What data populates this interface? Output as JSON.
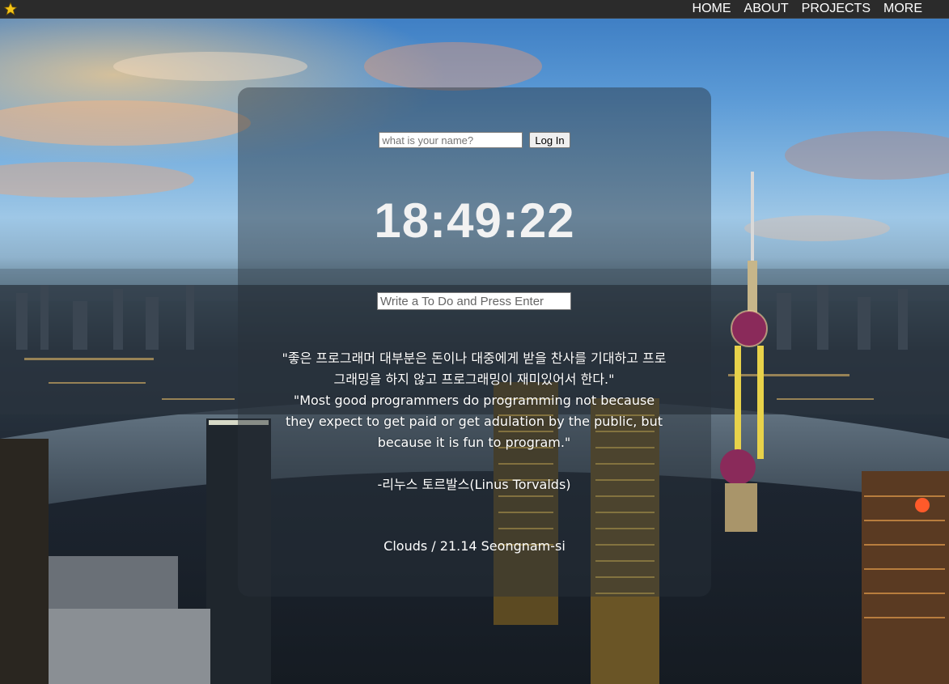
{
  "nav": {
    "items": [
      "HOME",
      "ABOUT",
      "PROJECTS",
      "MORE"
    ]
  },
  "login": {
    "placeholder": "what is your name?",
    "button_label": "Log In"
  },
  "clock": {
    "time": "18:49:22"
  },
  "todo": {
    "placeholder": "Write a To Do and Press Enter"
  },
  "quote": {
    "korean": "\"좋은 프로그래머 대부분은 돈이나 대중에게 받을 찬사를 기대하고 프로그래밍을 하지 않고 프로그래밍이 재미있어서 한다.\"",
    "english": "\"Most good programmers do programming not because they expect to get paid or get adulation by the public, but because it is fun to program.\"",
    "author": "-리누스 토르발스(Linus Torvalds)"
  },
  "weather": {
    "text": "Clouds / 21.14 Seongnam-si"
  },
  "colors": {
    "topbar": "#2b2b2b",
    "star": "#f5c518",
    "panel_overlay": "rgba(40,48,58,0.45)"
  },
  "icons": {
    "bookmark": "star-icon"
  }
}
